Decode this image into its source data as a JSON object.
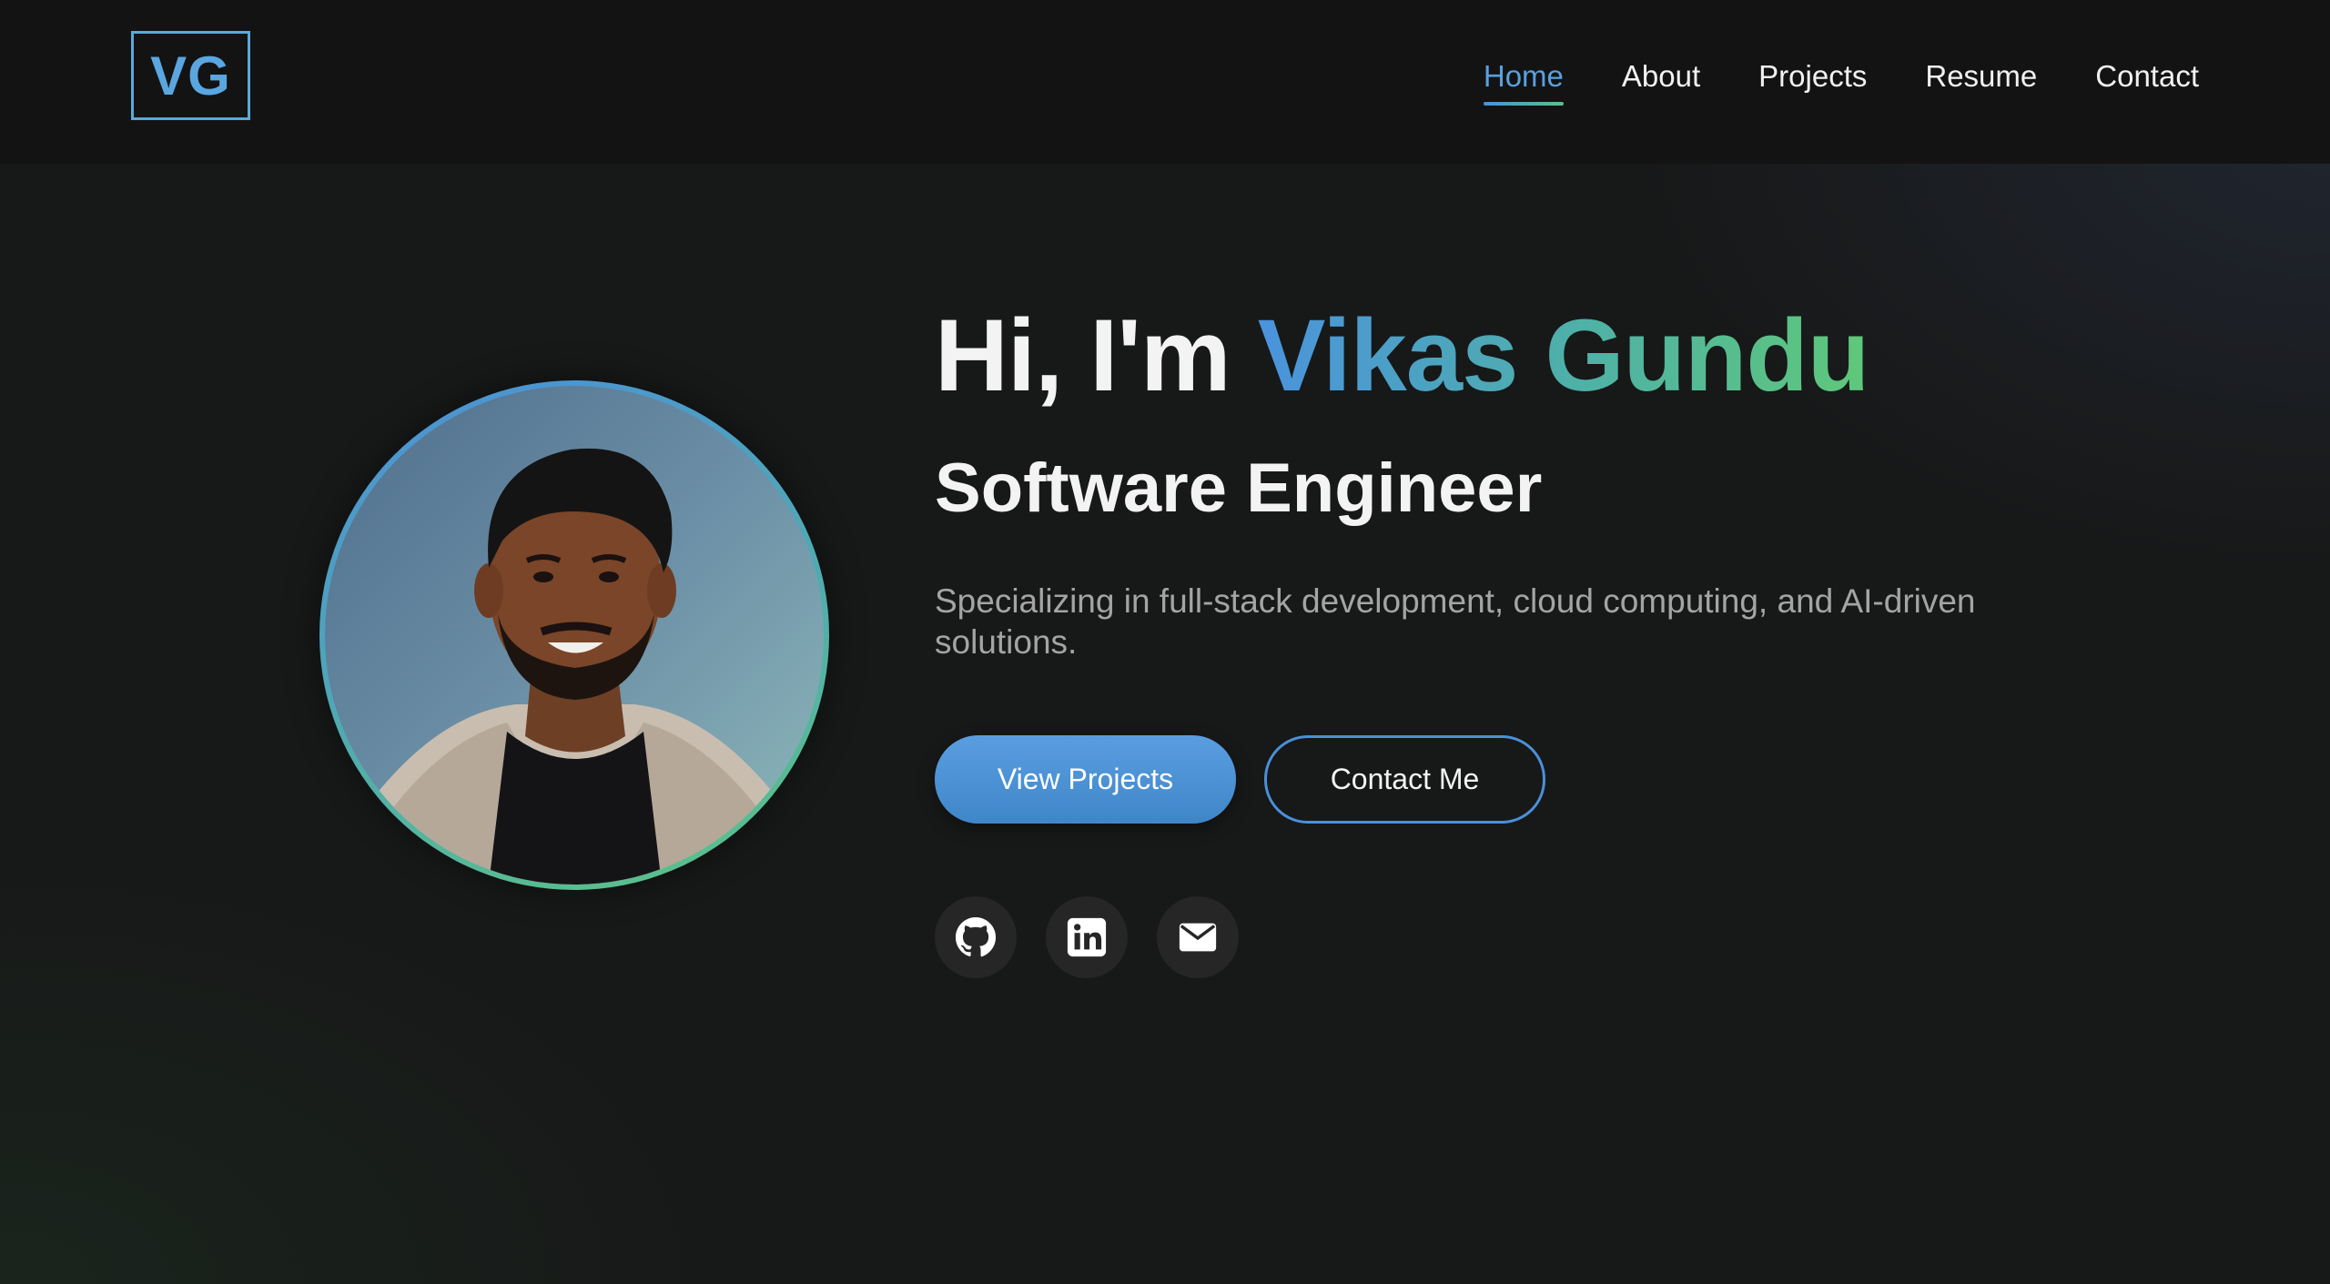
{
  "header": {
    "logo_text": "VG",
    "nav": [
      {
        "label": "Home",
        "active": true
      },
      {
        "label": "About",
        "active": false
      },
      {
        "label": "Projects",
        "active": false
      },
      {
        "label": "Resume",
        "active": false
      },
      {
        "label": "Contact",
        "active": false
      }
    ]
  },
  "hero": {
    "greeting": "Hi, I'm ",
    "name": "Vikas Gundu",
    "role": "Software Engineer",
    "description": "Specializing in full-stack development, cloud computing, and AI-driven solutions.",
    "primary_button": "View Projects",
    "secondary_button": "Contact Me",
    "socials": [
      {
        "icon": "github-icon"
      },
      {
        "icon": "linkedin-icon"
      },
      {
        "icon": "email-icon"
      }
    ]
  },
  "colors": {
    "accent_blue": "#4a90d9",
    "accent_green": "#5cc483",
    "background": "#171818",
    "header_bg": "#131313"
  }
}
